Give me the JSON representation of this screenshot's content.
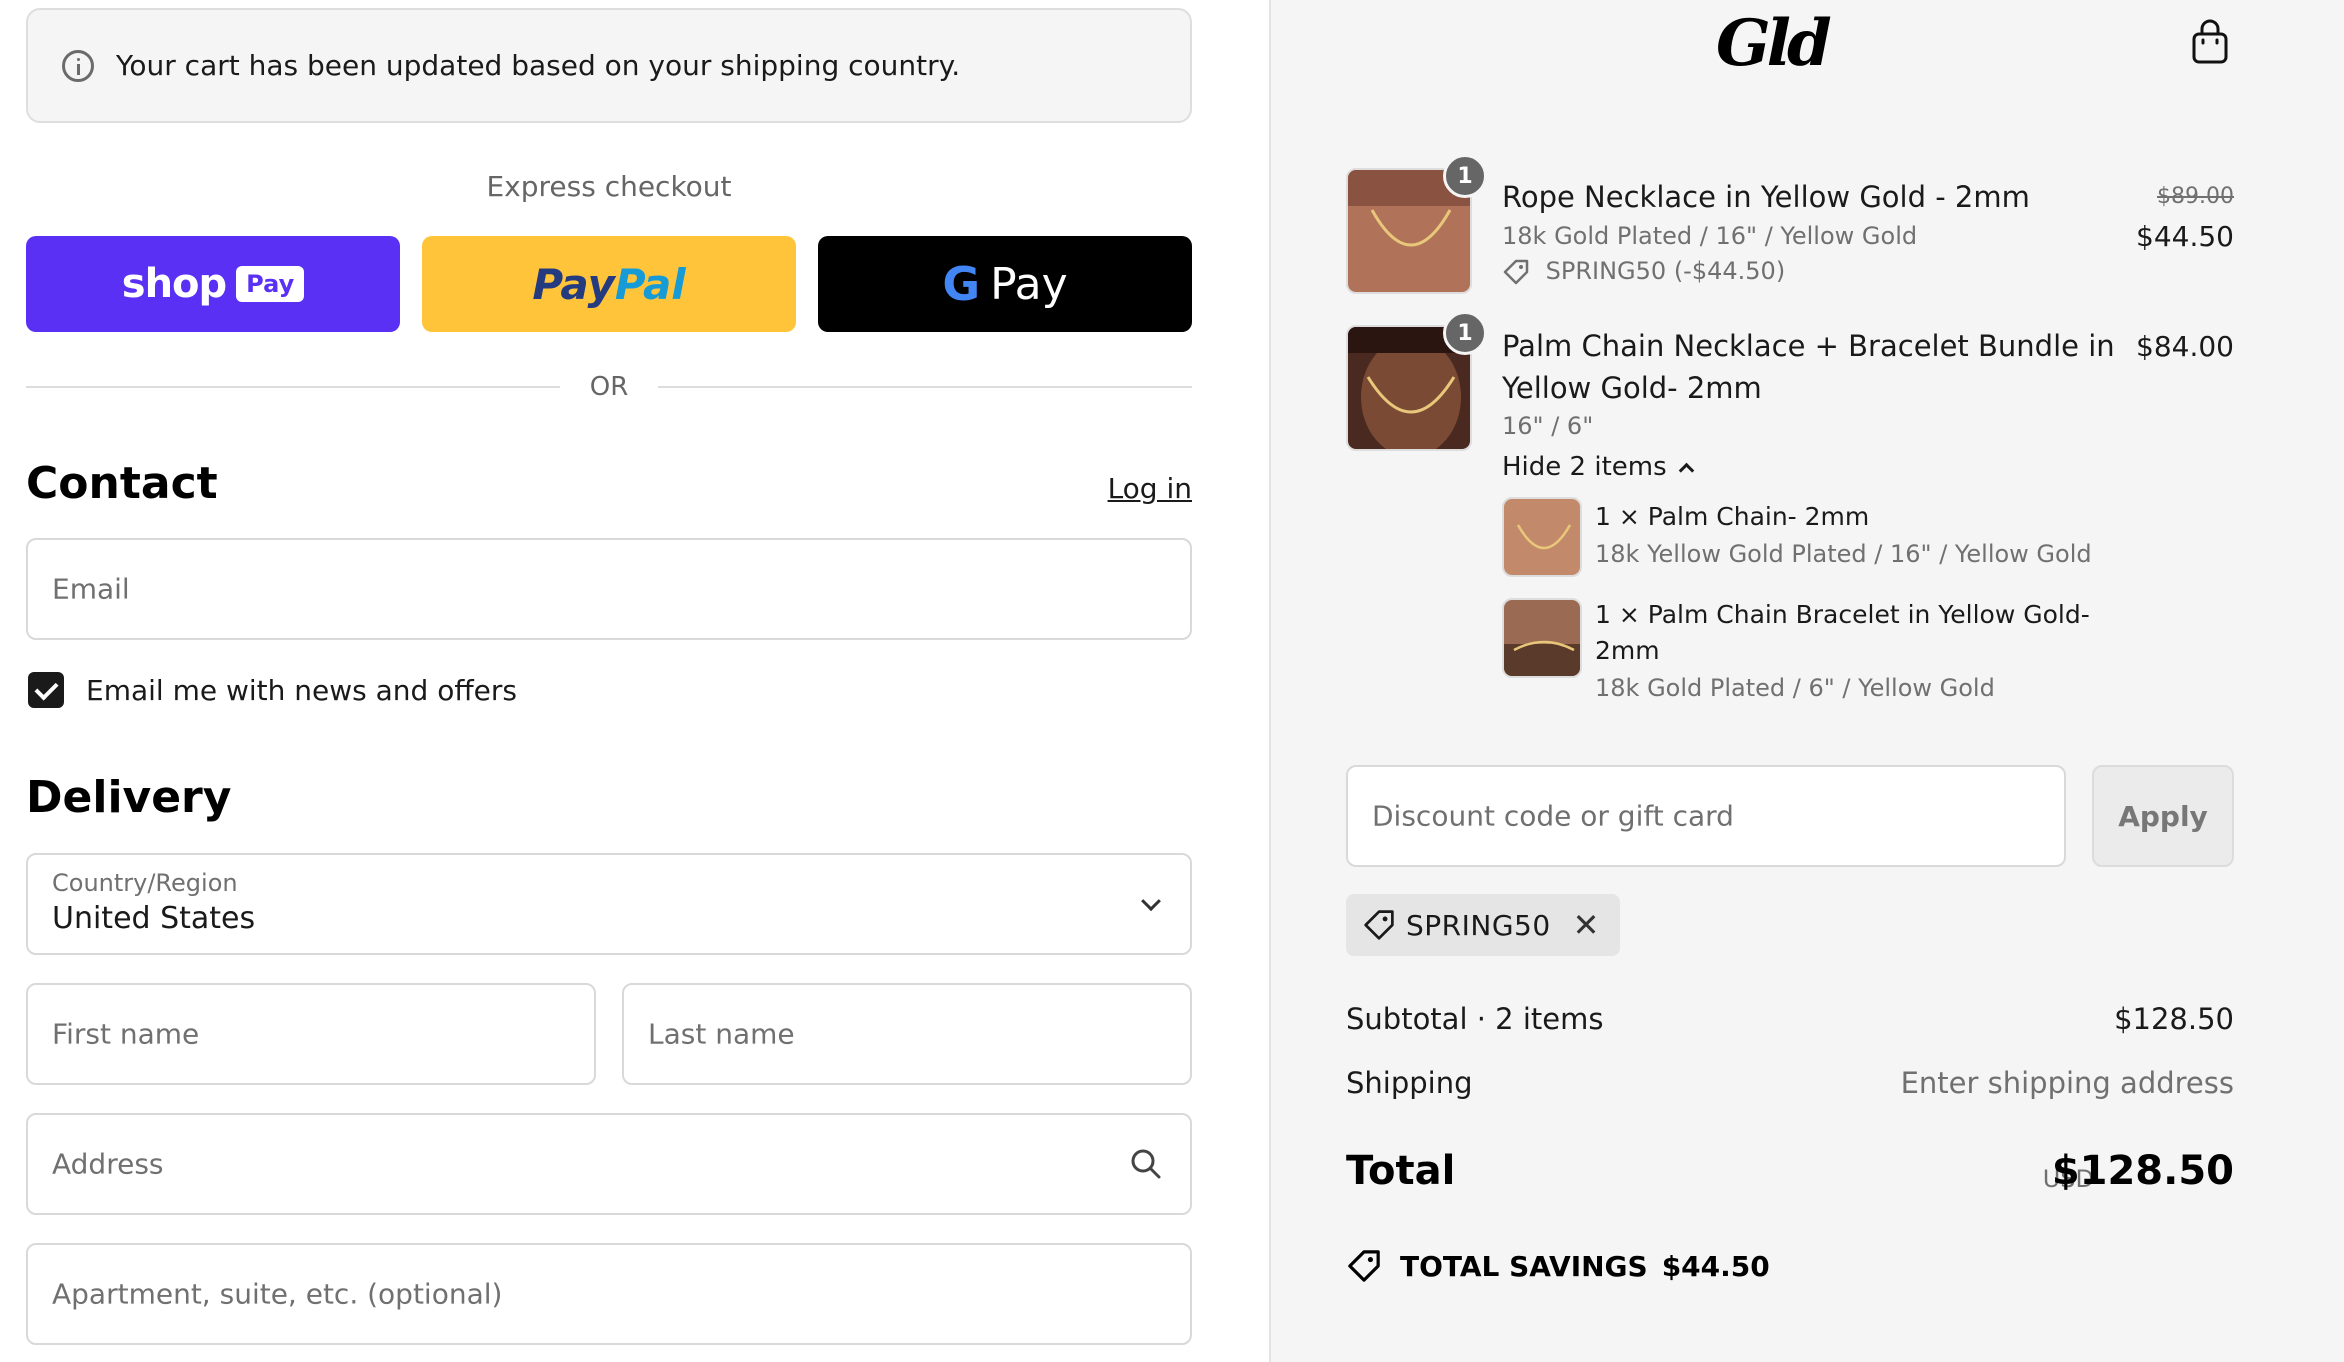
{
  "notice": {
    "text": "Your cart has been updated based on your shipping country."
  },
  "express": {
    "label": "Express checkout",
    "shop_pay": {
      "word": "shop",
      "pill": "Pay"
    },
    "paypal": {
      "pay": "Pay",
      "pal": "Pal"
    },
    "gpay": {
      "g": "G",
      "word": "Pay"
    },
    "or": "OR"
  },
  "contact": {
    "title": "Contact",
    "login": "Log in",
    "email_placeholder": "Email",
    "newsletter_label": "Email me with news and offers",
    "newsletter_checked": true
  },
  "delivery": {
    "title": "Delivery",
    "country_label": "Country/Region",
    "country_value": "United States",
    "first_name_placeholder": "First name",
    "last_name_placeholder": "Last name",
    "address_placeholder": "Address",
    "apartment_placeholder": "Apartment, suite, etc. (optional)"
  },
  "brand": {
    "logo": "Gld"
  },
  "cart": {
    "items": [
      {
        "qty": "1",
        "title": "Rope Necklace in Yellow Gold - 2mm",
        "variant": "18k Gold Plated / 16\" / Yellow Gold",
        "discount": "SPRING50 (-$44.50)",
        "price_old": "$89.00",
        "price": "$44.50"
      },
      {
        "qty": "1",
        "title_line1": "Palm Chain Necklace + Bracelet Bundle in",
        "title_line2": "Yellow Gold- 2mm",
        "variant": "16\" / 6\"",
        "price": "$84.00",
        "toggle": "Hide 2 items",
        "sub_items": [
          {
            "title": "1 × Palm Chain- 2mm",
            "variant": "18k Yellow Gold Plated / 16\" / Yellow Gold"
          },
          {
            "title_line1": "1 × Palm Chain Bracelet in Yellow Gold-",
            "title_line2": "2mm",
            "variant": "18k Gold Plated / 6\" / Yellow Gold"
          }
        ]
      }
    ]
  },
  "discount": {
    "placeholder": "Discount code or gift card",
    "apply": "Apply",
    "applied_code": "SPRING50"
  },
  "summary": {
    "subtotal_label": "Subtotal · 2 items",
    "subtotal_value": "$128.50",
    "shipping_label": "Shipping",
    "shipping_value": "Enter shipping address",
    "total_label": "Total",
    "currency": "USD",
    "total_value": "$128.50",
    "savings_label": "TOTAL SAVINGS",
    "savings_value": "$44.50"
  },
  "colors": {
    "shop_pay": "#5a31f4",
    "paypal": "#ffc439",
    "gpay": "#000000",
    "sidebar_bg": "#f5f5f5"
  }
}
